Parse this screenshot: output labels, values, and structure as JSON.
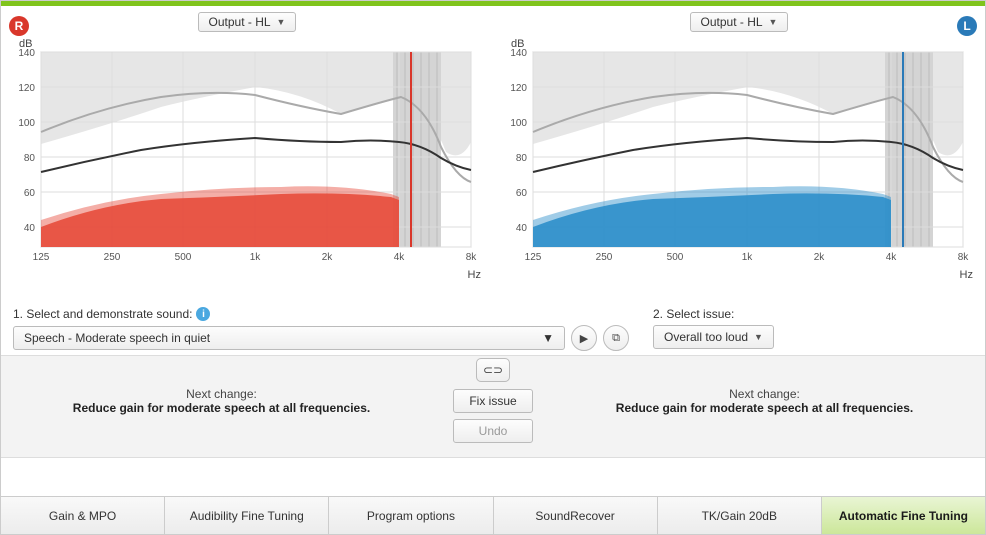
{
  "dropdowns": {
    "output_left": "Output - HL",
    "output_right": "Output - HL"
  },
  "chart_labels": {
    "y_unit": "dB",
    "x_unit": "Hz",
    "y_ticks": [
      "140",
      "120",
      "100",
      "80",
      "60",
      "40"
    ],
    "x_ticks": [
      "125",
      "250",
      "500",
      "1k",
      "2k",
      "4k",
      "8k"
    ]
  },
  "step1": {
    "label": "1. Select and demonstrate sound:",
    "value": "Speech - Moderate speech in quiet"
  },
  "step2": {
    "label": "2. Select issue:",
    "value": "Overall too loud"
  },
  "next_change": {
    "title_r": "Next change:",
    "desc_r": "Reduce gain for moderate speech at all frequencies.",
    "title_l": "Next change:",
    "desc_l": "Reduce gain for moderate speech at all frequencies."
  },
  "buttons": {
    "fix": "Fix issue",
    "undo": "Undo"
  },
  "tabs": {
    "t0": "Gain & MPO",
    "t1": "Audibility Fine Tuning",
    "t2": "Program options",
    "t3": "SoundRecover",
    "t4": "TK/Gain 20dB",
    "t5": "Automatic Fine Tuning"
  },
  "chart_data": [
    {
      "type": "line",
      "side": "R",
      "title": "Output - HL (Right)",
      "xlabel": "Hz",
      "ylabel": "dB",
      "x_ticks": [
        125,
        250,
        500,
        1000,
        2000,
        4000,
        8000
      ],
      "ylim": [
        30,
        140
      ],
      "series": [
        {
          "name": "MPO_upper",
          "values_at_ticks": [
            95,
            107,
            115,
            116,
            106,
            112,
            65
          ]
        },
        {
          "name": "target_black",
          "values_at_ticks": [
            72,
            82,
            88,
            93,
            90,
            90,
            78
          ]
        },
        {
          "name": "speech_band_upper",
          "values_at_ticks": [
            45,
            58,
            60,
            62,
            63,
            58,
            30
          ]
        },
        {
          "name": "speech_band_mid",
          "values_at_ticks": [
            38,
            55,
            57,
            58,
            60,
            57,
            30
          ]
        },
        {
          "name": "speech_band_lower",
          "values_at_ticks": [
            35,
            42,
            40,
            40,
            40,
            42,
            30
          ]
        }
      ],
      "marker_x_hz": 5000,
      "color": "#e74c3c"
    },
    {
      "type": "line",
      "side": "L",
      "title": "Output - HL (Left)",
      "xlabel": "Hz",
      "ylabel": "dB",
      "x_ticks": [
        125,
        250,
        500,
        1000,
        2000,
        4000,
        8000
      ],
      "ylim": [
        30,
        140
      ],
      "series": [
        {
          "name": "MPO_upper",
          "values_at_ticks": [
            95,
            107,
            115,
            116,
            106,
            112,
            65
          ]
        },
        {
          "name": "target_black",
          "values_at_ticks": [
            72,
            82,
            88,
            93,
            90,
            90,
            78
          ]
        },
        {
          "name": "speech_band_upper",
          "values_at_ticks": [
            45,
            58,
            60,
            62,
            63,
            58,
            30
          ]
        },
        {
          "name": "speech_band_mid",
          "values_at_ticks": [
            38,
            55,
            57,
            58,
            60,
            57,
            30
          ]
        },
        {
          "name": "speech_band_lower",
          "values_at_ticks": [
            35,
            42,
            40,
            40,
            40,
            42,
            30
          ]
        }
      ],
      "marker_x_hz": 5000,
      "color": "#2d8fca"
    }
  ]
}
